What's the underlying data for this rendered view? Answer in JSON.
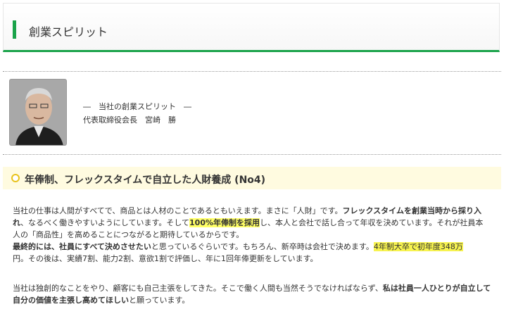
{
  "header": {
    "title": "創業スピリット"
  },
  "profile": {
    "photo_icon": "person-portrait",
    "subtitle": "―　当社の創業スピリット　―",
    "name_line": "代表取締役会長　宮崎　勝"
  },
  "section": {
    "title": "年俸制、フレックスタイムで自立した人財養成 (No4)"
  },
  "body": {
    "p1_line1_a": "当社の仕事は人間がすべてで、商品とは人材のことであるともいえます。まさに「人財」です。",
    "p1_line1_b": "フレックスタイムを創業当時から採り入",
    "p1_line2_a": "れ",
    "p1_line2_b": "、なるべく働きやすいようにしています。そして",
    "p1_line2_c": "100%年俸制を採用",
    "p1_line2_d": "し、本人と会社で話し合って年収を決めています。それが社員本",
    "p1_line3": "人の「商品性」を高めることにつながると期待しているからです。",
    "p1_line4_a": "最終的には、社員にすべて決めさせたい",
    "p1_line4_b": "と思っているぐらいです。もちろん、新卒時は会社で決めます。",
    "p1_line4_c": "4年制大卒で初年度348万",
    "p1_line5": "円。その後は、実績7割、能力2割、意欲1割で評価し、年に1回年俸更新をしています。",
    "p2_line1_a": "当社は独創的なことをやり、顧客にも自己主張をしてきた。そこで働く人間も当然そうでなければならず、",
    "p2_line1_b": "私は社員一人ひとりが自立して",
    "p2_line2_a": "自分の価値を主張し高めてほしい",
    "p2_line2_b": "と願っています。"
  },
  "colors": {
    "accent": "#1aa34a",
    "highlight": "#f7f34f",
    "section_bg": "#fffbe0"
  }
}
